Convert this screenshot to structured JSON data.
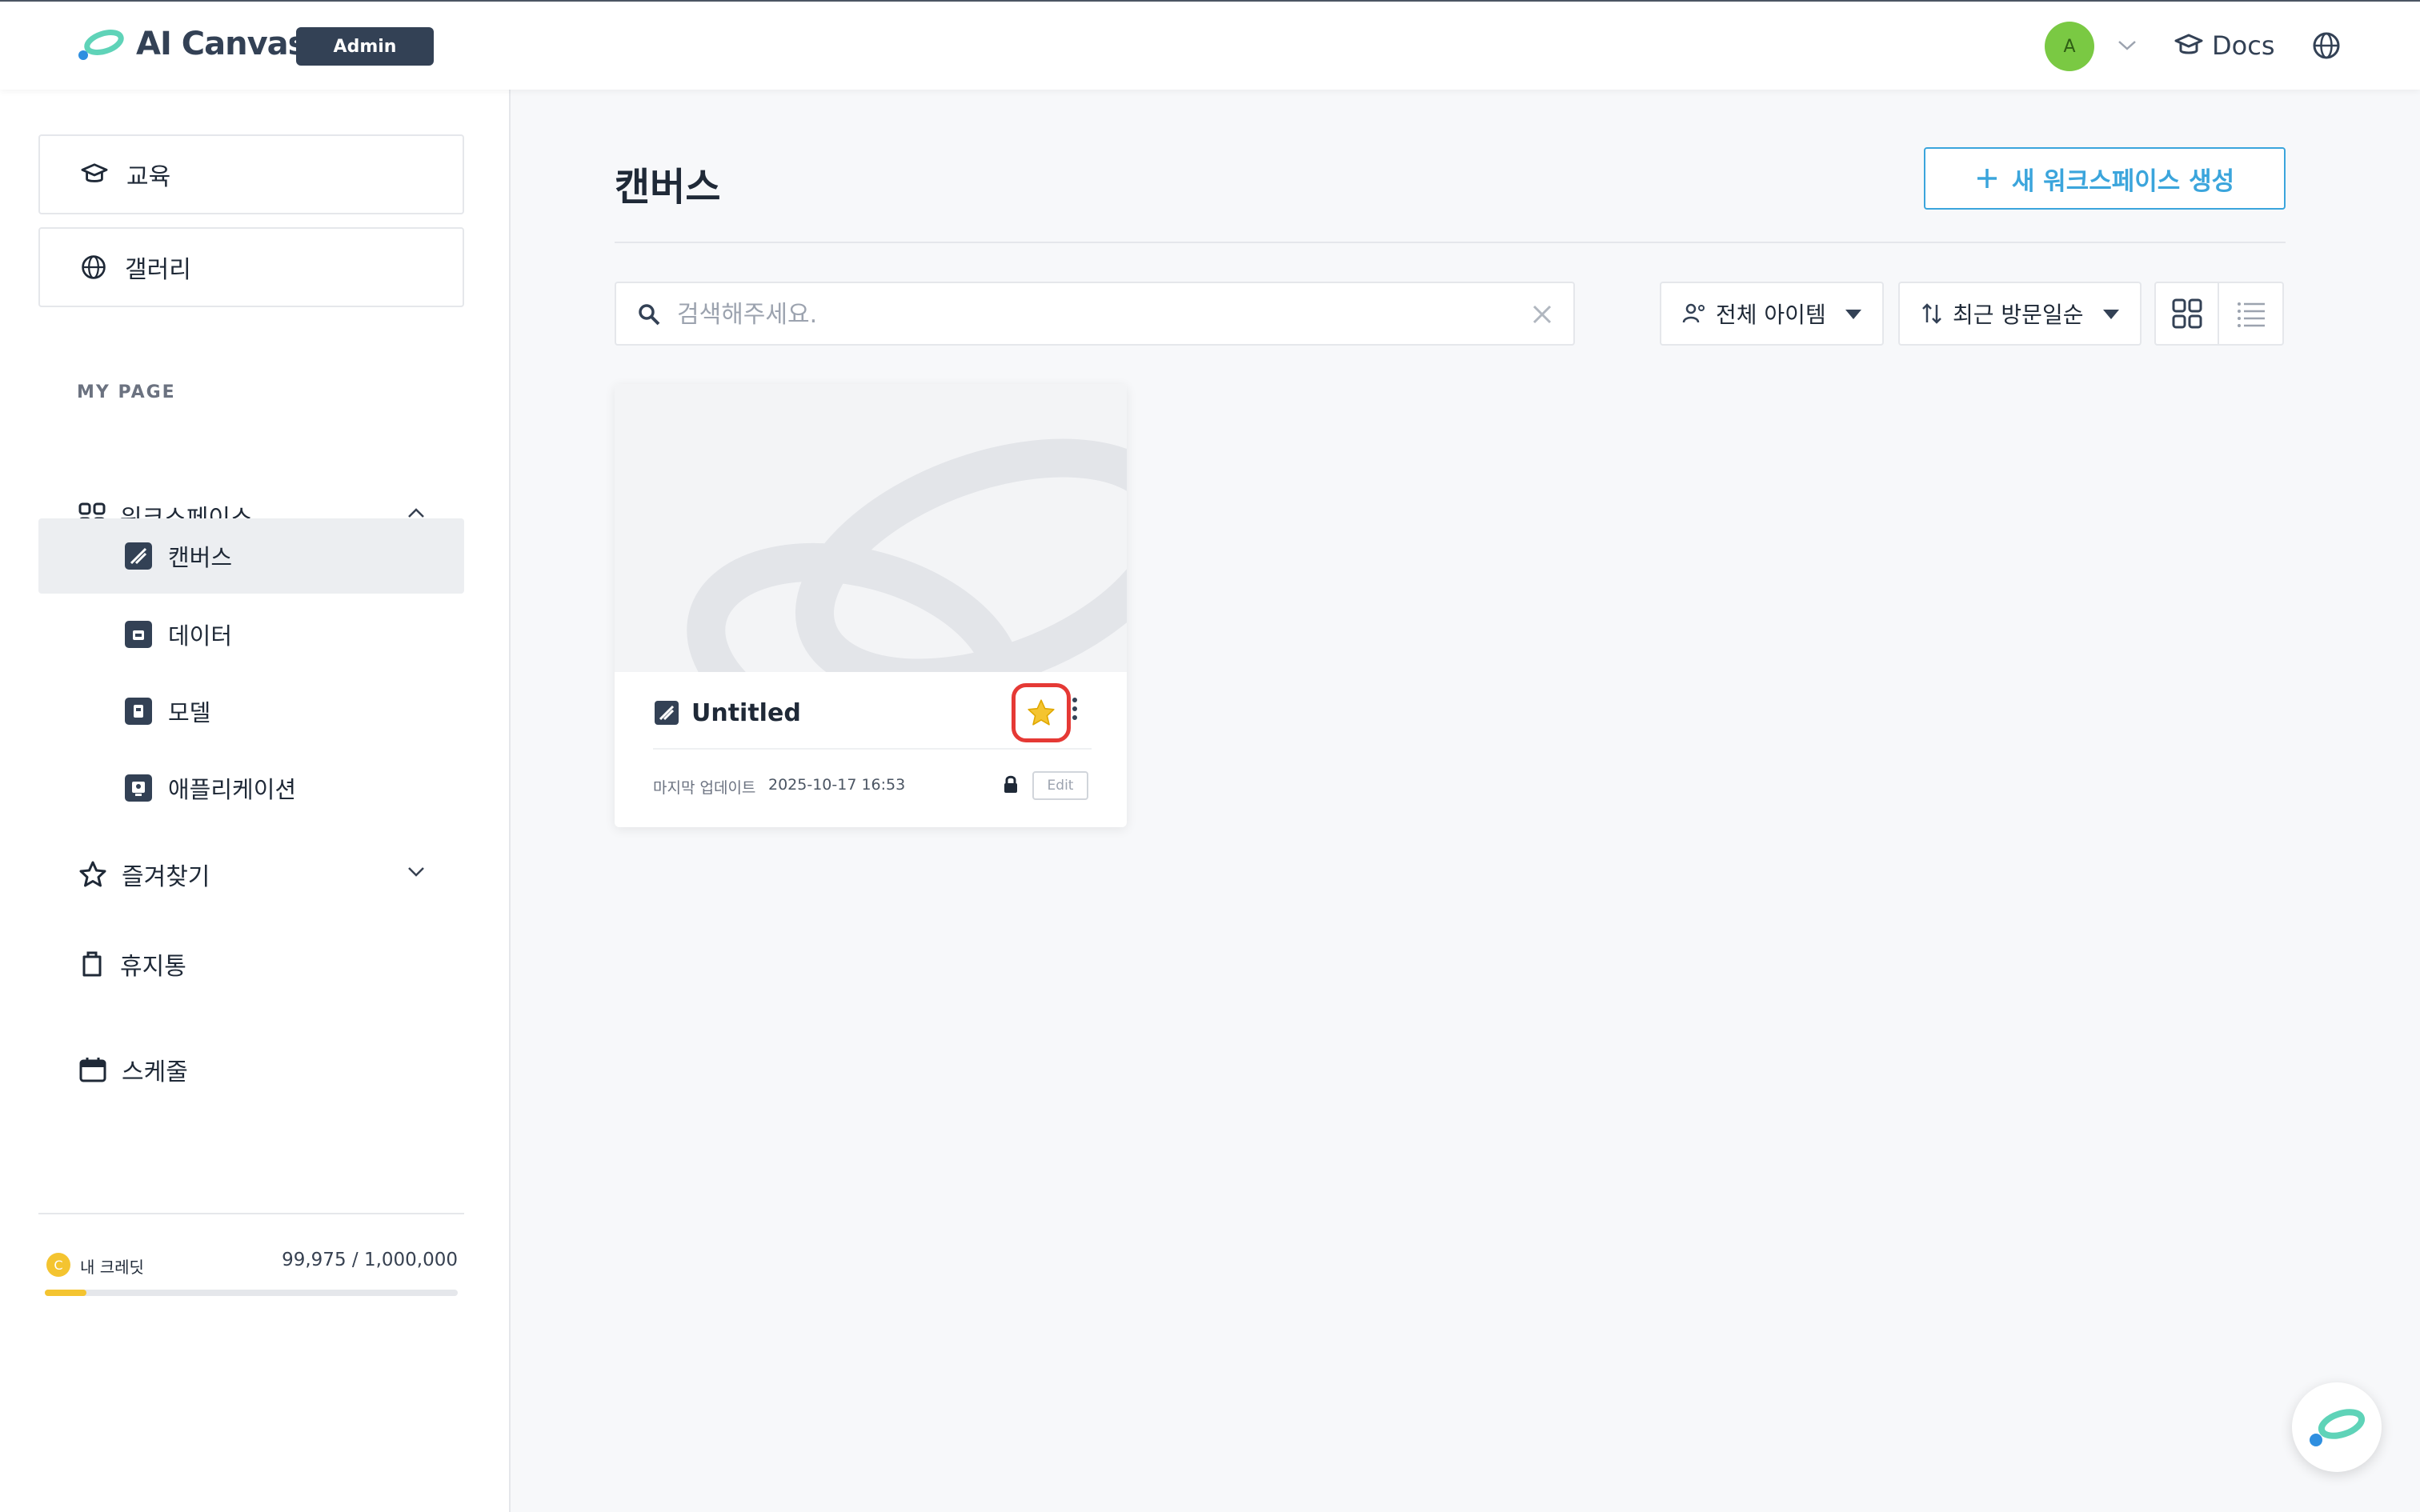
{
  "header": {
    "app_name": "AI Canvas",
    "badge": "Admin",
    "avatar_initial": "A",
    "docs_label": "Docs"
  },
  "sidebar": {
    "top_links": [
      {
        "label": "교육",
        "icon": "graduation-cap-icon"
      },
      {
        "label": "갤러리",
        "icon": "globe-icon"
      }
    ],
    "section_label": "MY PAGE",
    "workspace": {
      "label": "워크스페이스",
      "expanded": true,
      "items": [
        {
          "label": "캔버스",
          "icon": "canvas-icon",
          "active": true
        },
        {
          "label": "데이터",
          "icon": "data-icon",
          "active": false
        },
        {
          "label": "모델",
          "icon": "model-icon",
          "active": false
        },
        {
          "label": "애플리케이션",
          "icon": "application-icon",
          "active": false
        }
      ]
    },
    "favorites_label": "즐겨찾기",
    "trash_label": "휴지통",
    "schedule_label": "스케줄",
    "credit": {
      "label": "내 크레딧",
      "value": "99,975 / 1,000,000",
      "used_fraction": 0.1
    }
  },
  "main": {
    "title": "캔버스",
    "new_button_label": "새 워크스페이스 생성",
    "search": {
      "placeholder": "검색해주세요.",
      "value": ""
    },
    "filter_label": "전체 아이템",
    "sort_label": "최근 방문일순",
    "cards": [
      {
        "title": "Untitled",
        "favorited": true,
        "updated_label": "마지막 업데이트",
        "updated_at": "2025-10-17 16:53",
        "edit_label": "Edit"
      }
    ]
  },
  "colors": {
    "accent": "#3ba5dc",
    "sidebar_active": "#eceef1",
    "badge_bg": "#334155",
    "star": "#f4c430",
    "highlight": "#e53935"
  }
}
